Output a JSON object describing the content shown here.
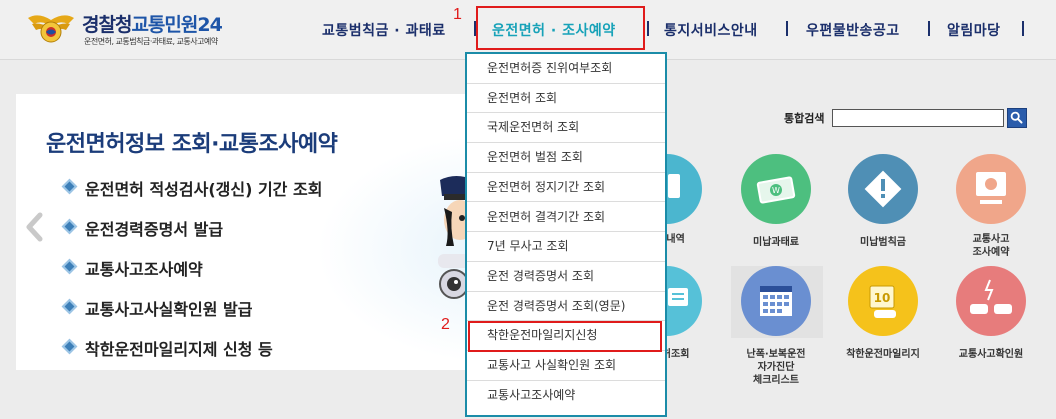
{
  "header": {
    "logo_title_a": "경찰청",
    "logo_title_b": "교통민원24",
    "logo_subtitle": "운전면허, 교통범칙금·과태료, 교통사고예약"
  },
  "nav": {
    "items": [
      {
        "label": "교통범칙금 · 과태료"
      },
      {
        "label": "운전면허 · 조사예약"
      },
      {
        "label": "통지서비스안내"
      },
      {
        "label": "우편물반송공고"
      },
      {
        "label": "알림마당"
      }
    ],
    "marker_1": "1",
    "marker_2": "2"
  },
  "panel": {
    "title": "운전면허정보 조회·교통조사예약",
    "items": [
      "운전면허 적성검사(갱신) 기간 조회",
      "운전경력증명서 발급",
      "교통사고조사예약",
      "교통사고사실확인원 발급",
      "착한운전마일리지제 신청 등"
    ]
  },
  "dropdown": {
    "items": [
      "운전면허증 진위여부조회",
      "운전면허 조회",
      "국제운전면허 조회",
      "운전면허 벌점 조회",
      "운전면허 정지기간 조회",
      "운전면허 결격기간 조회",
      "7년 무사고 조회",
      "운전 경력증명서 조회",
      "운전 경력증명서 조회(영문)",
      "착한운전마일리지신청",
      "교통사고 사실확인원 조회",
      "교통사고조사예약"
    ],
    "highlighted_index": 9
  },
  "search": {
    "label": "통합검색",
    "value": ""
  },
  "quick": {
    "row1": [
      "통내역",
      "미납과태료",
      "미납범칙금",
      "교통사고\n조사예약"
    ],
    "row2": [
      "면허조회",
      "난폭·보복운전\n자가진단\n체크리스트",
      "착한운전마일리지",
      "교통사고확인원"
    ]
  },
  "colors": {
    "brand_navy": "#1b2f6b",
    "active_teal": "#17a2b8",
    "highlight_red": "#e01b1b",
    "dropdown_border": "#1b8ca8"
  }
}
